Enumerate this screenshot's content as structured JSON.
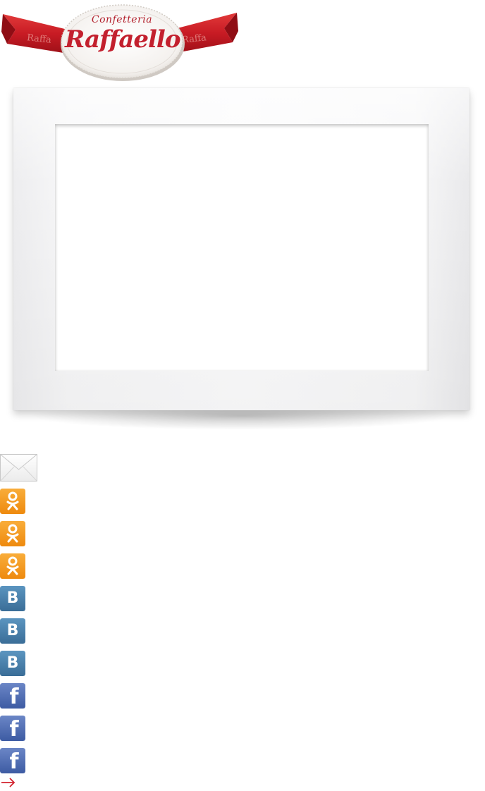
{
  "logo": {
    "brand_line": "Confetteria",
    "brand_name": "Raffaello",
    "ribbon_left": "Raffa",
    "ribbon_right": "Raffa"
  },
  "icons": {
    "mail": "envelope-icon",
    "odnoklassniki": "odnoklassniki-icon",
    "vkontakte": "vk-icon",
    "facebook": "facebook-icon",
    "next": "arrow-right-icon",
    "vk_letter": "B",
    "fb_letter": "f"
  },
  "colors": {
    "brand_red": "#c3202e",
    "ok_orange": "#f59a1c",
    "vk_blue": "#4a7fa8",
    "fb_blue": "#4a67b0"
  }
}
